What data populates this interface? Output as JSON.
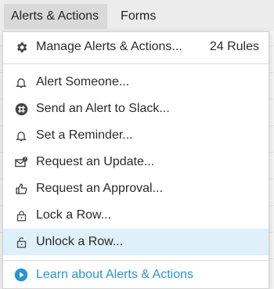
{
  "tabs": [
    {
      "label": "Alerts & Actions"
    },
    {
      "label": "Forms"
    }
  ],
  "menu": {
    "manage": {
      "label": "Manage Alerts & Actions...",
      "count": "24 Rules",
      "icon": "gear-icon"
    },
    "items": [
      {
        "label": "Alert Someone...",
        "icon": "bell-icon"
      },
      {
        "label": "Send an Alert to Slack...",
        "icon": "slack-icon"
      },
      {
        "label": "Set a Reminder...",
        "icon": "bell-icon"
      },
      {
        "label": "Request an Update...",
        "icon": "envelope-update-icon"
      },
      {
        "label": "Request an Approval...",
        "icon": "thumbs-up-icon"
      },
      {
        "label": "Lock a Row...",
        "icon": "lock-icon"
      },
      {
        "label": "Unlock a Row...",
        "icon": "unlock-icon"
      }
    ],
    "learn": {
      "label": "Learn about Alerts & Actions",
      "icon": "play-circle-icon"
    }
  },
  "colors": {
    "highlight": "#def0fa",
    "link": "#2a93d5",
    "tab_active": "#d9d9d9"
  }
}
